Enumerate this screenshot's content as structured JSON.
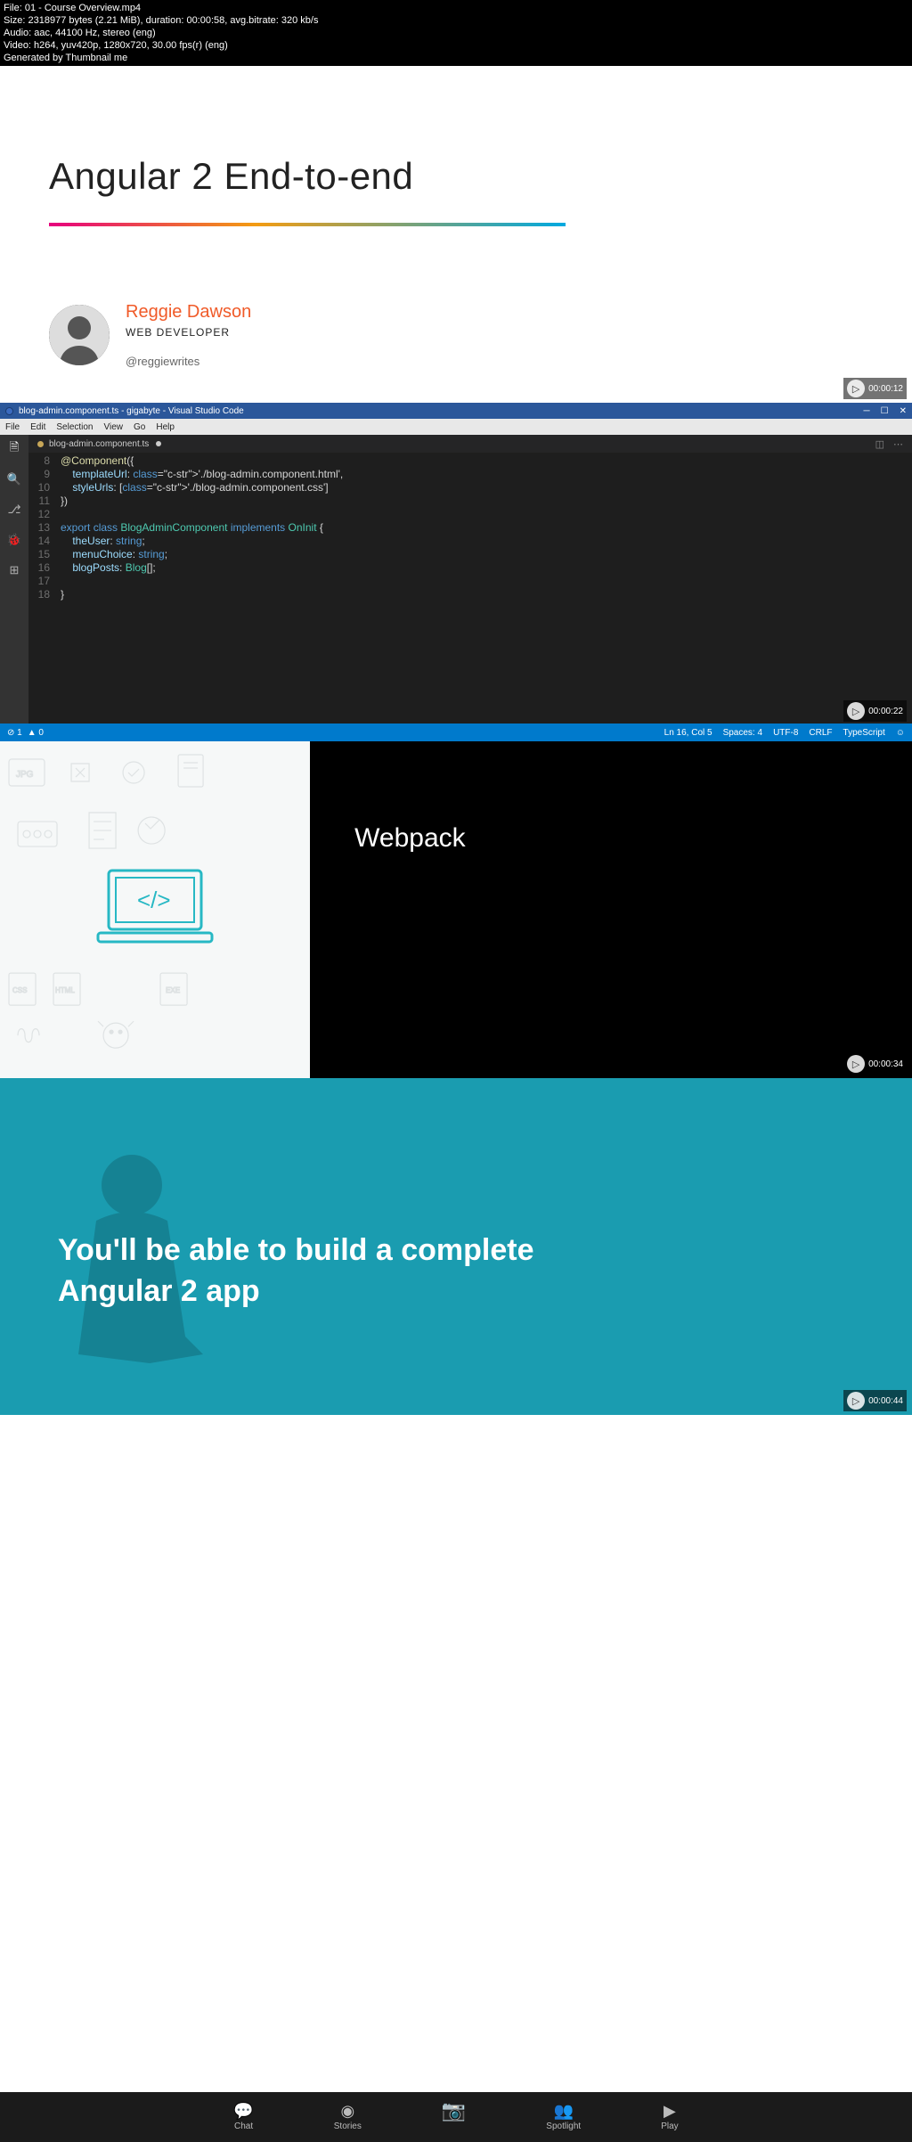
{
  "meta": {
    "l1": "File: 01 - Course Overview.mp4",
    "l2": "Size: 2318977 bytes (2.21 MiB), duration: 00:00:58, avg.bitrate: 320 kb/s",
    "l3": "Audio: aac, 44100 Hz, stereo (eng)",
    "l4": "Video: h264, yuv420p, 1280x720, 30.00 fps(r) (eng)",
    "l5": "Generated by Thumbnail me"
  },
  "slide1": {
    "title": "Angular 2 End-to-end",
    "author": "Reggie Dawson",
    "role": "WEB DEVELOPER",
    "handle": "@reggiewrites",
    "ts": "00:00:12"
  },
  "slide2": {
    "window_title": "blog-admin.component.ts - gigabyte - Visual Studio Code",
    "menu": [
      "File",
      "Edit",
      "Selection",
      "View",
      "Go",
      "Help"
    ],
    "tab": "blog-admin.component.ts",
    "status_left": [
      "⊘ 1",
      "▲ 0"
    ],
    "status_right": [
      "Ln 16, Col 5",
      "Spaces: 4",
      "UTF-8",
      "CRLF",
      "TypeScript",
      "☺"
    ],
    "code": [
      {
        "n": "8",
        "txt": "@component({",
        "cls": [
          "fn"
        ]
      },
      {
        "n": "9",
        "txt": "    templateUrl: './blog-admin.component.html',"
      },
      {
        "n": "10",
        "txt": "    styleUrls: ['./blog-admin.component.css']"
      },
      {
        "n": "11",
        "txt": "})"
      },
      {
        "n": "12",
        "txt": ""
      },
      {
        "n": "13",
        "txt": "export class BlogAdminComponent implements OnInit {"
      },
      {
        "n": "14",
        "txt": "    theUser: string;"
      },
      {
        "n": "15",
        "txt": "    menuChoice: string;"
      },
      {
        "n": "16",
        "txt": "    blogPosts: Blog[];"
      },
      {
        "n": "17",
        "txt": ""
      },
      {
        "n": "18",
        "txt": "}"
      }
    ],
    "ts": "00:00:22"
  },
  "slide3": {
    "title": "Webpack",
    "ts": "00:00:34"
  },
  "slide4": {
    "text": "You'll be able to build a complete Angular 2 app",
    "ts": "00:00:44"
  },
  "nav": {
    "items": [
      {
        "icon": "💬",
        "label": "Chat"
      },
      {
        "icon": "◉",
        "label": "Stories"
      },
      {
        "icon": "📷",
        "label": ""
      },
      {
        "icon": "👥",
        "label": "Spotlight"
      },
      {
        "icon": "▶",
        "label": "Play"
      }
    ]
  }
}
